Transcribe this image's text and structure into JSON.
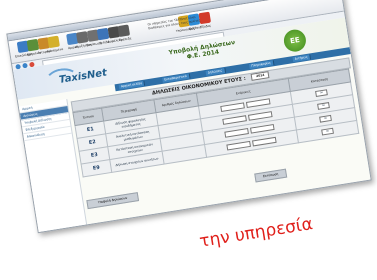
{
  "toolbar": {
    "items": [
      {
        "label": "Επικόλληση",
        "icon": "paste-icon",
        "color": "#3b7cc4"
      },
      {
        "label": "Εργαλεία",
        "icon": "tools-icon",
        "color": "#5a8f3a"
      },
      {
        "label": "Ιστορικό",
        "icon": "history-icon",
        "color": "#c98a2a"
      },
      {
        "label": "Αγαπημένα",
        "icon": "favorites-icon",
        "color": "#d4b02a"
      },
      {
        "label": "Αρχική",
        "icon": "home-icon",
        "color": "#4a86c7"
      },
      {
        "label": "Αναζήτηση",
        "icon": "search-icon",
        "color": "#6a6a6a"
      },
      {
        "label": "Εκτύπωση",
        "icon": "print-icon",
        "color": "#707070"
      },
      {
        "label": "Σελίδα",
        "icon": "page-icon",
        "color": "#3d74b8"
      },
      {
        "label": "Ασφάλεια",
        "icon": "security-icon",
        "color": "#4a4a4a"
      },
      {
        "label": "Τράπεζα",
        "icon": "bank-icon",
        "color": "#5b5b5b"
      },
      {
        "label": "Υπολογισμός",
        "icon": "calc-icon",
        "color": "#d3a41e"
      },
      {
        "label": "Βοήθεια",
        "icon": "help-icon",
        "color": "#2c8bd6"
      },
      {
        "label": "Έξοδος",
        "icon": "exit-icon",
        "color": "#d23a2a"
      }
    ],
    "ribbon_text": "Οι υπηρεσίες του TAXISnet είναι διαθέσιμες για όλους τους πολίτες"
  },
  "header": {
    "logo": "TaxisNet",
    "title_line1": "Υποβολή Δηλώσεων",
    "title_line2": "Φ.Ε. 2014",
    "badge": "ΕΕ"
  },
  "menubar": {
    "items": [
      "Αρχική σελίδα",
      "Εκκαθαριστικά",
      "Δηλώσεις",
      "Πληροφορίες",
      "Αιτήσεις"
    ]
  },
  "sidebar": {
    "items": [
      "Αρχική",
      "Δηλώσεις",
      "Υποβολή Δήλωσης",
      "Επεξεργασία",
      "Αποσύνδεση"
    ]
  },
  "form": {
    "title": "ΔΗΛΩΣΕΙΣ ΟΙΚΟΝΟΜΙΚΟΥ ΕΤΟΥΣ :",
    "year": "2014",
    "columns": [
      "Έντυπο",
      "Περιγραφή",
      "Αριθμός δηλώσεων",
      "Ενέργειες",
      "Κατάσταση"
    ],
    "rows": [
      {
        "code": "Ε1",
        "desc": "Δήλωση φορολογίας εισοδήματος",
        "count": "",
        "status": "ΟΚ"
      },
      {
        "code": "Ε2",
        "desc": "Αναλυτική κατάσταση μισθωμάτων",
        "count": "",
        "status": "ΟΚ"
      },
      {
        "code": "Ε3",
        "desc": "Κατάσταση οικονομικών στοιχείων",
        "count": "",
        "status": "ΟΚ"
      },
      {
        "code": "Ε9",
        "desc": "Δήλωση στοιχείων ακινήτων",
        "count": "",
        "status": "ΟΚ"
      }
    ],
    "bottom_label": "Υποβολή δηλώσεων",
    "save_label": "Εκτύπωση"
  },
  "caption": "την υπηρεσία"
}
